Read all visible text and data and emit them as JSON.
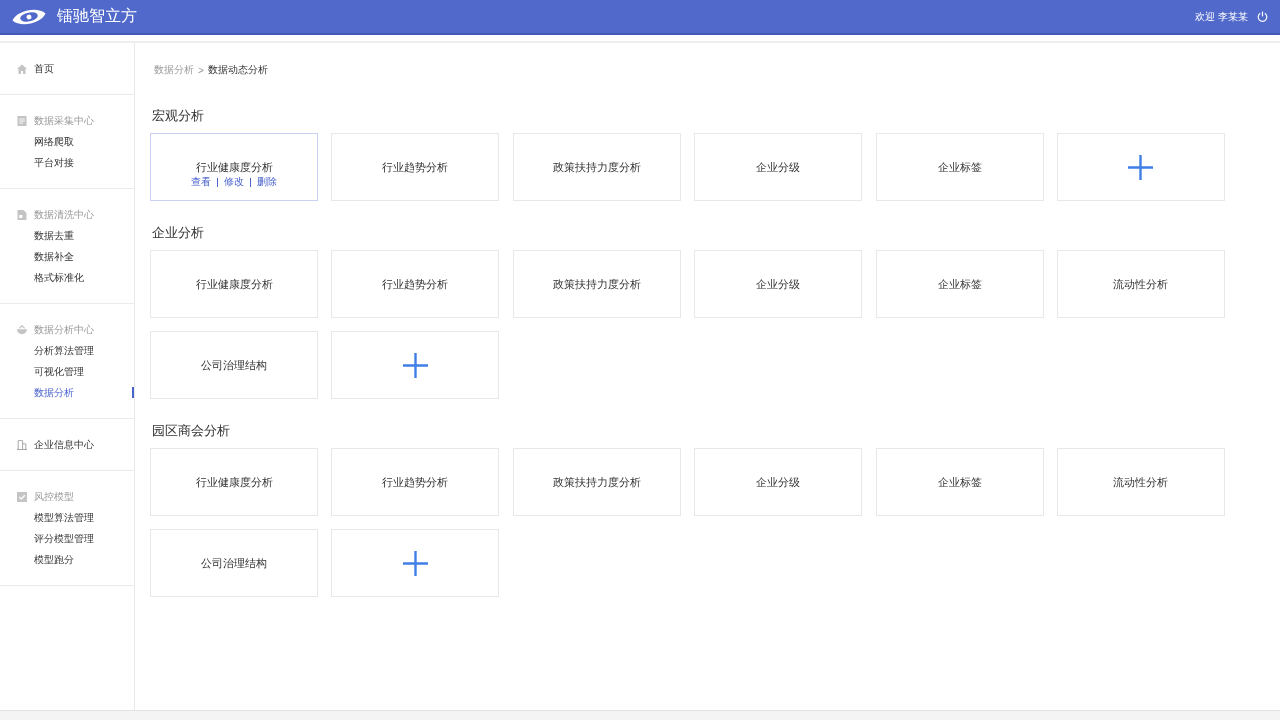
{
  "header": {
    "logo_text": "镭驰智立方",
    "greeting": "欢迎 李某某"
  },
  "sidebar": {
    "groups": [
      {
        "kind": "link",
        "label": "首页",
        "selected": false
      },
      {
        "kind": "group",
        "label": "数据采集中心",
        "items": [
          {
            "label": "网络爬取",
            "selected": false
          },
          {
            "label": "平台对接",
            "selected": false
          }
        ]
      },
      {
        "kind": "group",
        "label": "数据清洗中心",
        "items": [
          {
            "label": "数据去重",
            "selected": false
          },
          {
            "label": "数据补全",
            "selected": false
          },
          {
            "label": "格式标准化",
            "selected": false
          }
        ]
      },
      {
        "kind": "group",
        "label": "数据分析中心",
        "items": [
          {
            "label": "分析算法管理",
            "selected": false
          },
          {
            "label": "可视化管理",
            "selected": false
          },
          {
            "label": "数据分析",
            "selected": true
          }
        ]
      },
      {
        "kind": "link",
        "label": "企业信息中心",
        "selected": false
      },
      {
        "kind": "group",
        "label": "风控模型",
        "items": [
          {
            "label": "模型算法管理",
            "selected": false
          },
          {
            "label": "评分模型管理",
            "selected": false
          },
          {
            "label": "模型跑分",
            "selected": false
          }
        ]
      }
    ]
  },
  "breadcrumb": {
    "items": [
      "数据分析",
      "数据动态分析"
    ],
    "separator": ">"
  },
  "sections": [
    {
      "title": "宏观分析",
      "cards": [
        {
          "kind": "analysis",
          "label": "行业健康度分析",
          "highlighted": true,
          "actions": [
            "查看",
            "修改",
            "删除"
          ]
        },
        {
          "kind": "analysis",
          "label": "行业趋势分析",
          "highlighted": false
        },
        {
          "kind": "analysis",
          "label": "政策扶持力度分析",
          "highlighted": false
        },
        {
          "kind": "analysis",
          "label": "企业分级",
          "highlighted": false
        },
        {
          "kind": "analysis",
          "label": "企业标签",
          "highlighted": false
        },
        {
          "kind": "add"
        }
      ]
    },
    {
      "title": "企业分析",
      "cards": [
        {
          "kind": "analysis",
          "label": "行业健康度分析",
          "highlighted": false
        },
        {
          "kind": "analysis",
          "label": "行业趋势分析",
          "highlighted": false
        },
        {
          "kind": "analysis",
          "label": "政策扶持力度分析",
          "highlighted": false
        },
        {
          "kind": "analysis",
          "label": "企业分级",
          "highlighted": false
        },
        {
          "kind": "analysis",
          "label": "企业标签",
          "highlighted": false
        },
        {
          "kind": "analysis",
          "label": "流动性分析",
          "highlighted": false
        },
        {
          "kind": "analysis",
          "label": "公司治理结构",
          "highlighted": false
        },
        {
          "kind": "add"
        }
      ]
    },
    {
      "title": "园区商会分析",
      "cards": [
        {
          "kind": "analysis",
          "label": "行业健康度分析",
          "highlighted": false
        },
        {
          "kind": "analysis",
          "label": "行业趋势分析",
          "highlighted": false
        },
        {
          "kind": "analysis",
          "label": "政策扶持力度分析",
          "highlighted": false
        },
        {
          "kind": "analysis",
          "label": "企业分级",
          "highlighted": false
        },
        {
          "kind": "analysis",
          "label": "企业标签",
          "highlighted": false
        },
        {
          "kind": "analysis",
          "label": "流动性分析",
          "highlighted": false
        },
        {
          "kind": "analysis",
          "label": "公司治理结构",
          "highlighted": false
        },
        {
          "kind": "add"
        }
      ]
    }
  ]
}
